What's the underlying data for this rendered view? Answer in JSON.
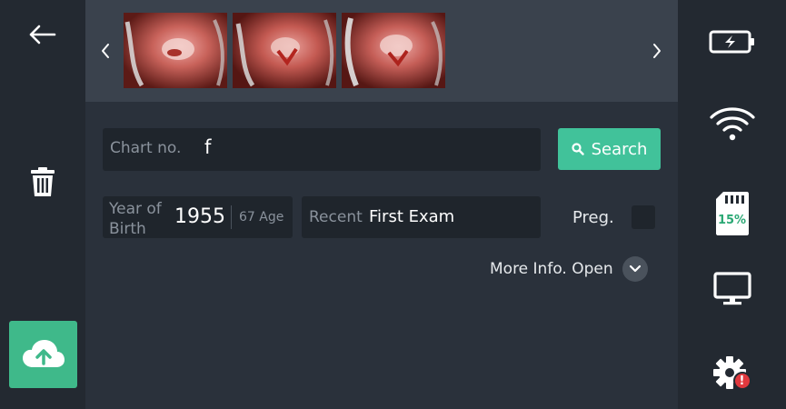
{
  "toolbar": {
    "back_icon": "arrow-left-icon",
    "delete_icon": "trash-icon",
    "upload_icon": "cloud-upload-icon",
    "upload_color": "#3fb98a"
  },
  "thumbnails": {
    "prev_icon": "chevron-left-icon",
    "next_icon": "chevron-right-icon",
    "count": 3
  },
  "form": {
    "chart_no_label": "Chart no.",
    "chart_no_value": "f",
    "search_label": "Search",
    "search_color": "#41c29a",
    "year_of_birth_label": "Year of Birth",
    "year_of_birth_value": "1955",
    "age_label": "67 Age",
    "recent_label": "Recent",
    "recent_value": "First Exam",
    "preg_label": "Preg.",
    "preg_checked": false,
    "more_info_label": "More Info. Open"
  },
  "status": {
    "battery_icon": "battery-charging-icon",
    "wifi_icon": "wifi-icon",
    "sd_card_icon": "sd-card-icon",
    "sd_card_percent": "15%",
    "monitor_icon": "monitor-icon",
    "settings_icon": "gear-icon",
    "settings_alert": "!",
    "accent_color": "#3fb98a",
    "alert_color": "#e0393e"
  }
}
